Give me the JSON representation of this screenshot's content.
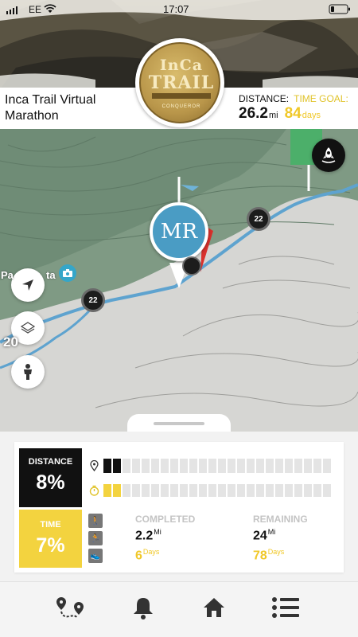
{
  "status_bar": {
    "carrier": "EE",
    "time": "17:07"
  },
  "event": {
    "title": "Inca Trail Virtual Marathon",
    "distance_label": "DISTANCE:",
    "distance_value": "26.2",
    "distance_unit": "mi",
    "time_goal_label": "TIME GOAL:",
    "time_goal_value": "84",
    "time_goal_unit": "days"
  },
  "medal": {
    "line1": "InCa",
    "line2": "TRAIL",
    "sub": "CONQUEROR"
  },
  "map": {
    "user_initials": "MR",
    "markers": [
      "22",
      "22"
    ],
    "place_label": "Pa",
    "place_label_right": "ta",
    "edge_number": "20",
    "icons": [
      "navigation-arrow-icon",
      "layers-icon",
      "person-icon",
      "rocket-icon",
      "camera-icon"
    ]
  },
  "stats": {
    "distance_label": "DISTANCE",
    "distance_pct": "8%",
    "distance_fraction": 0.08,
    "time_label": "TIME",
    "time_pct": "7%",
    "time_fraction": 0.07,
    "completed_label": "COMPLETED",
    "remaining_label": "REMAINING",
    "completed_distance": "2.2",
    "completed_distance_unit": "Mi",
    "completed_days": "6",
    "completed_days_unit": "Days",
    "remaining_distance": "24",
    "remaining_distance_unit": "Mi",
    "remaining_days": "78",
    "remaining_days_unit": "Days"
  },
  "colors": {
    "accent_yellow": "#f3d33f",
    "route_blue": "#4a9cc4",
    "dark": "#111111"
  },
  "nav": [
    "route-map-icon",
    "bell-icon",
    "home-icon",
    "menu-list-icon"
  ]
}
